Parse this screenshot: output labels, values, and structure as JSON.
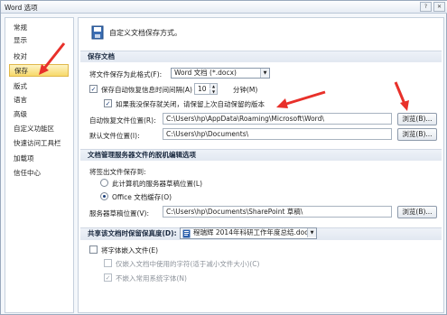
{
  "window": {
    "title": "Word 选项"
  },
  "sidebar": {
    "items": [
      {
        "label": "常规"
      },
      {
        "label": "显示"
      },
      {
        "label": "校对"
      },
      {
        "label": "保存",
        "selected": true
      },
      {
        "label": "版式"
      },
      {
        "label": "语言"
      },
      {
        "label": "高级"
      },
      {
        "label": "自定义功能区"
      },
      {
        "label": "快速访问工具栏"
      },
      {
        "label": "加载项"
      },
      {
        "label": "信任中心"
      }
    ]
  },
  "main": {
    "intro": "自定义文档保存方式。",
    "save_section": {
      "header": "保存文档",
      "format_label": "将文件保存为此格式(F):",
      "format_value": "Word 文档 (*.docx)",
      "autorecover_label": "保存自动恢复信息时间间隔(A)",
      "autorecover_minutes": "10",
      "minutes_label": "分钟(M)",
      "keep_last_label": "如果我没保存就关闭，请保留上次自动保留的版本",
      "autorecover_location_label": "自动恢复文件位置(R):",
      "autorecover_location_value": "C:\\Users\\hp\\AppData\\Roaming\\Microsoft\\Word\\",
      "default_location_label": "默认文件位置(I):",
      "default_location_value": "C:\\Users\\hp\\Documents\\",
      "browse_label": "浏览(B)..."
    },
    "offline_section": {
      "header": "文档管理服务器文件的脱机编辑选项",
      "checkout_label": "将签出文件保存到:",
      "radio1_label": "此计算机的服务器草稿位置(L)",
      "radio2_label": "Office 文档缓存(O)",
      "drafts_label": "服务器草稿位置(V):",
      "drafts_value": "C:\\Users\\hp\\Documents\\SharePoint 草稿\\",
      "browse_label": "浏览(B)..."
    },
    "fidelity_section": {
      "label": "共享该文档时保留保真度(D):",
      "doc_value": "程瑞辉 2014年科研工作年度总结.docx",
      "embed_fonts_label": "将字体嵌入文件(E)",
      "embed_used_only_label": "仅嵌入文档中使用的字符(适于减小文件大小)(C)",
      "no_common_fonts_label": "不嵌入常用系统字体(N)"
    }
  },
  "colors": {
    "selected_bg": "#f7d96a",
    "annotation_red": "#e8302a",
    "section_bg": "#e2e8f1"
  },
  "icons": {
    "header": "disk-save-icon",
    "doc": "word-document-icon"
  }
}
